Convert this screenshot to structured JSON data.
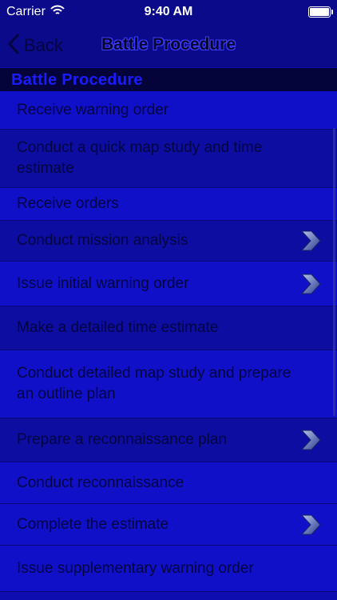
{
  "status_bar": {
    "carrier": "Carrier",
    "time": "9:40 AM"
  },
  "nav": {
    "back_label": "Back",
    "title": "Battle Procedure"
  },
  "section": {
    "header": "Battle Procedure"
  },
  "items": [
    {
      "label": "Receive warning order",
      "has_chevron": false
    },
    {
      "label": "Conduct a quick map study and time estimate",
      "has_chevron": false
    },
    {
      "label": "Receive orders",
      "has_chevron": false
    },
    {
      "label": "Conduct mission analysis",
      "has_chevron": true
    },
    {
      "label": "Issue initial warning order",
      "has_chevron": true
    },
    {
      "label": "Make a detailed time estimate",
      "has_chevron": false
    },
    {
      "label": "Conduct detailed map study and prepare an outline plan",
      "has_chevron": false
    },
    {
      "label": "Prepare a reconnaissance plan",
      "has_chevron": true
    },
    {
      "label": "Conduct reconnaissance",
      "has_chevron": false
    },
    {
      "label": "Complete the estimate",
      "has_chevron": true
    },
    {
      "label": "Issue supplementary warning order",
      "has_chevron": false
    }
  ],
  "colors": {
    "row_bright": "#1010c8",
    "row_dim": "#0d0da2",
    "text": "#050540"
  }
}
